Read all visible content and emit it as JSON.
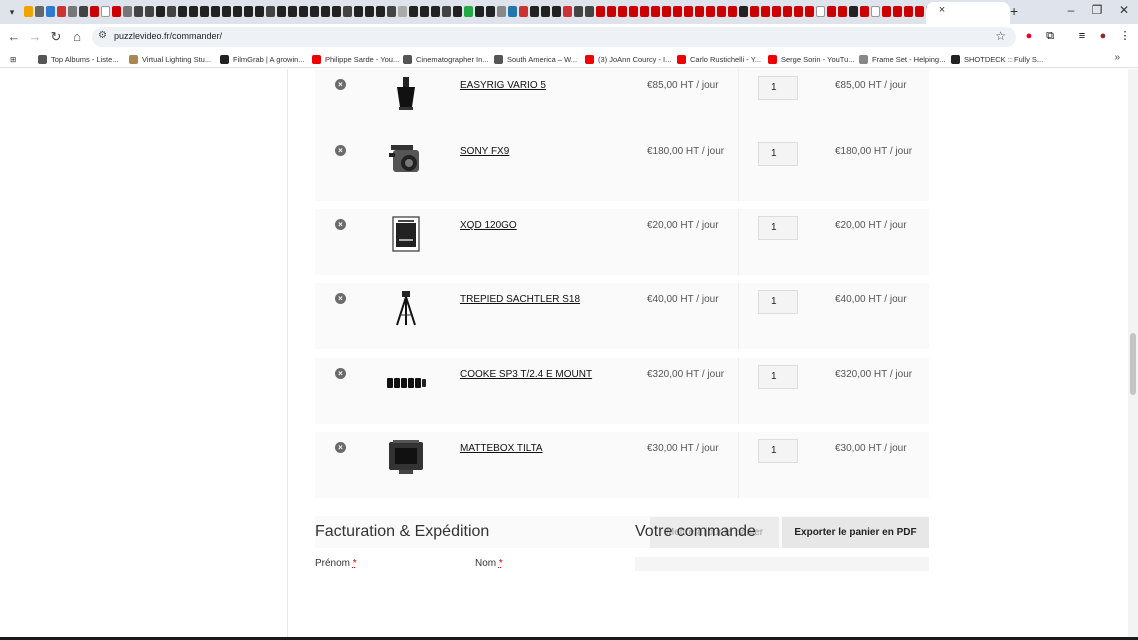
{
  "browser": {
    "url": "puzzlevideo.fr/commander/",
    "tab_close_glyph": "×",
    "new_tab_glyph": "+",
    "colors": {
      "tabstrip": "#dfe3eb",
      "omnibox": "#eef1f6"
    },
    "favicon_colors": [
      "#f0a400",
      "#666",
      "#2b7bd1",
      "#c33",
      "#777",
      "#444",
      "#c00",
      "#fff",
      "#c00",
      "#777",
      "#444",
      "#444",
      "#222",
      "#444",
      "#222",
      "#222",
      "#222",
      "#222",
      "#222",
      "#222",
      "#222",
      "#222",
      "#444",
      "#222",
      "#222",
      "#222",
      "#222",
      "#222",
      "#222",
      "#444",
      "#222",
      "#222",
      "#222",
      "#444",
      "#aaa",
      "#222",
      "#222",
      "#222",
      "#444",
      "#222",
      "#2a4",
      "#222",
      "#222",
      "#888",
      "#27a",
      "#c33",
      "#222",
      "#222",
      "#222",
      "#c33",
      "#444",
      "#444",
      "#c00",
      "#c00",
      "#c00",
      "#c00",
      "#c00",
      "#c00",
      "#c00",
      "#c00",
      "#c00",
      "#c00",
      "#c00",
      "#c00",
      "#c00",
      "#222",
      "#c00",
      "#c00",
      "#c00",
      "#c00",
      "#c00",
      "#c00",
      "#fff",
      "#c00",
      "#c00",
      "#222",
      "#c00",
      "#fff",
      "#c00",
      "#c00",
      "#c00",
      "#c00",
      "#c00",
      "#fff",
      "#c00",
      "#c00",
      "#c00",
      "#c00",
      "#3a9",
      "#c00",
      "#c00",
      "#c00",
      "#c00",
      "#333",
      "#c33",
      "#47a",
      "#c03",
      "#444",
      "#222",
      "#aaa"
    ],
    "bookmarks": [
      {
        "label": "Top Albums - Liste...",
        "icon": "paw-icon",
        "color": "#555"
      },
      {
        "label": "Virtual Lighting Stu...",
        "icon": "image-icon",
        "color": "#a85"
      },
      {
        "label": "FilmGrab | A growin...",
        "icon": "film-icon",
        "color": "#222"
      },
      {
        "label": "Philippe Sarde - You...",
        "icon": "youtube-icon",
        "color": "#e00"
      },
      {
        "label": "Cinematographer In...",
        "icon": "globe-icon",
        "color": "#555"
      },
      {
        "label": "South America – W...",
        "icon": "globe-icon",
        "color": "#555"
      },
      {
        "label": "(3) JoAnn Courcy - I...",
        "icon": "youtube-icon",
        "color": "#e00"
      },
      {
        "label": "Carlo Rustichelli - Y...",
        "icon": "youtube-icon",
        "color": "#e00"
      },
      {
        "label": "Serge Sorin - YouTu...",
        "icon": "youtube-icon",
        "color": "#e00"
      },
      {
        "label": "Frame Set - Helping...",
        "icon": "frameset-icon",
        "color": "#888"
      },
      {
        "label": "SHOTDECK :: Fully S...",
        "icon": "shotdeck-icon",
        "color": "#222"
      }
    ]
  },
  "cart": {
    "items": [
      {
        "name": "EASYRIG VARIO 5",
        "price": "€85,00 HT / jour",
        "qty": "1",
        "subtotal": "€85,00 HT / jour",
        "thumb": "easyrig"
      },
      {
        "name": "SONY FX9",
        "price": "€180,00 HT / jour",
        "qty": "1",
        "subtotal": "€180,00 HT / jour",
        "thumb": "camera"
      },
      {
        "name": "XQD 120GO",
        "price": "€20,00 HT / jour",
        "qty": "1",
        "subtotal": "€20,00 HT / jour",
        "thumb": "card"
      },
      {
        "name": "TREPIED SACHTLER S18",
        "price": "€40,00 HT / jour",
        "qty": "1",
        "subtotal": "€40,00 HT / jour",
        "thumb": "tripod"
      },
      {
        "name": "COOKE SP3 T/2.4 E MOUNT",
        "price": "€320,00 HT / jour",
        "qty": "1",
        "subtotal": "€320,00 HT / jour",
        "thumb": "lenses"
      },
      {
        "name": "MATTEBOX TILTA",
        "price": "€30,00 HT / jour",
        "qty": "1",
        "subtotal": "€30,00 HT / jour",
        "thumb": "mattebox"
      }
    ],
    "remove_glyph": "×",
    "update_label": "Mettre à jour le panier",
    "export_label": "Exporter le panier en PDF"
  },
  "checkout": {
    "billing_title": "Facturation & Expédition",
    "order_title": "Votre commande",
    "first_name_label": "Prénom",
    "last_name_label": "Nom",
    "required_mark": "*"
  }
}
